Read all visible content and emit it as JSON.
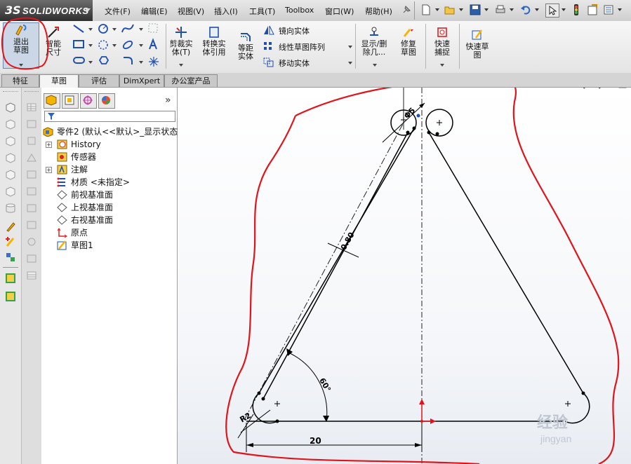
{
  "app": {
    "logo_ds": "3S",
    "logo_name": "SOLIDWORKS"
  },
  "menu": [
    "文件(F)",
    "编辑(E)",
    "视图(V)",
    "插入(I)",
    "工具(T)",
    "Toolbox",
    "窗口(W)",
    "帮助(H)"
  ],
  "ribbon": {
    "exit_sketch": "退出草图",
    "smart_dim": "智能尺寸",
    "trim": "剪裁实体(T)",
    "convert": "转换实体引用",
    "offset": "等距实体",
    "mirror": "镜向实体",
    "linear_pattern": "线性草图阵列",
    "move": "移动实体",
    "show_delete": "显示/删除几...",
    "repair": "修复草图",
    "quick_snap": "快速捕捉",
    "rapid_sketch": "快速草图"
  },
  "tabs": [
    "特征",
    "草图",
    "评估",
    "DimXpert",
    "办公室产品"
  ],
  "active_tab": "草图",
  "tree": {
    "part": "零件2 (默认<<默认>_显示状态",
    "items": [
      "History",
      "传感器",
      "注解",
      "材质 <未指定>",
      "前视基准面",
      "上视基准面",
      "右视基准面",
      "原点",
      "草图1"
    ]
  },
  "collapse_arrow": "»",
  "sketch": {
    "dim_circle": "Φ5",
    "dim_offset": "0.80",
    "dim_angle": "60°",
    "dim_radius": "R2",
    "dim_length": "20"
  },
  "watermark": {
    "line1": "经验",
    "line2": "jingyan"
  },
  "colors": {
    "annotation_red": "#e0141a",
    "sketch_line": "#000000"
  }
}
